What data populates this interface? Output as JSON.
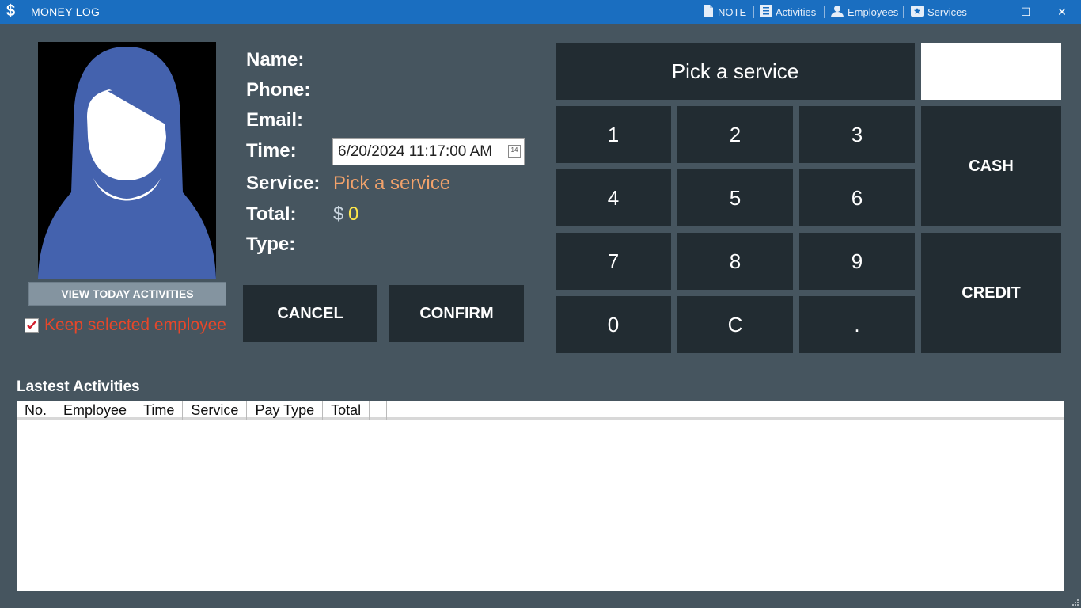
{
  "app": {
    "title": "MONEY LOG",
    "icon": "dollar-icon"
  },
  "topnav": [
    {
      "label": "NOTE",
      "icon": "note-icon"
    },
    {
      "label": "Activities",
      "icon": "list-icon"
    },
    {
      "label": "Employees",
      "icon": "person-icon"
    },
    {
      "label": "Services",
      "icon": "services-icon"
    }
  ],
  "window": {
    "minimize": "—",
    "maximize": "☐",
    "close": "✕"
  },
  "profile": {
    "view_today_label": "VIEW TODAY ACTIVITIES",
    "keep_selected_label": "Keep selected employee",
    "keep_selected_checked": true
  },
  "form": {
    "name_label": "Name:",
    "phone_label": "Phone:",
    "email_label": "Email:",
    "time_label": "Time:",
    "time_value": "6/20/2024 11:17:00 AM",
    "service_label": "Service:",
    "service_value": "Pick a service",
    "total_label": "Total:",
    "total_currency": "$",
    "total_value": "0",
    "type_label": "Type:",
    "cancel_label": "CANCEL",
    "confirm_label": "CONFIRM"
  },
  "keypad": {
    "display": "Pick a service",
    "keys": [
      "1",
      "2",
      "3",
      "4",
      "5",
      "6",
      "7",
      "8",
      "9",
      "0",
      "C",
      "."
    ],
    "cash_label": "CASH",
    "credit_label": "CREDIT"
  },
  "activities": {
    "title": "Lastest Activities",
    "columns": [
      "No.",
      "Employee",
      "Time",
      "Service",
      "Pay Type",
      "Total",
      "",
      ""
    ]
  },
  "colors": {
    "background": "#46555f",
    "titlebar": "#1a6ec0",
    "button_dark": "#222c32",
    "service_text": "#f2a26b",
    "total_text": "#ffe84a",
    "keep_text": "#e7472a",
    "avatar_fill": "#4462ae"
  }
}
